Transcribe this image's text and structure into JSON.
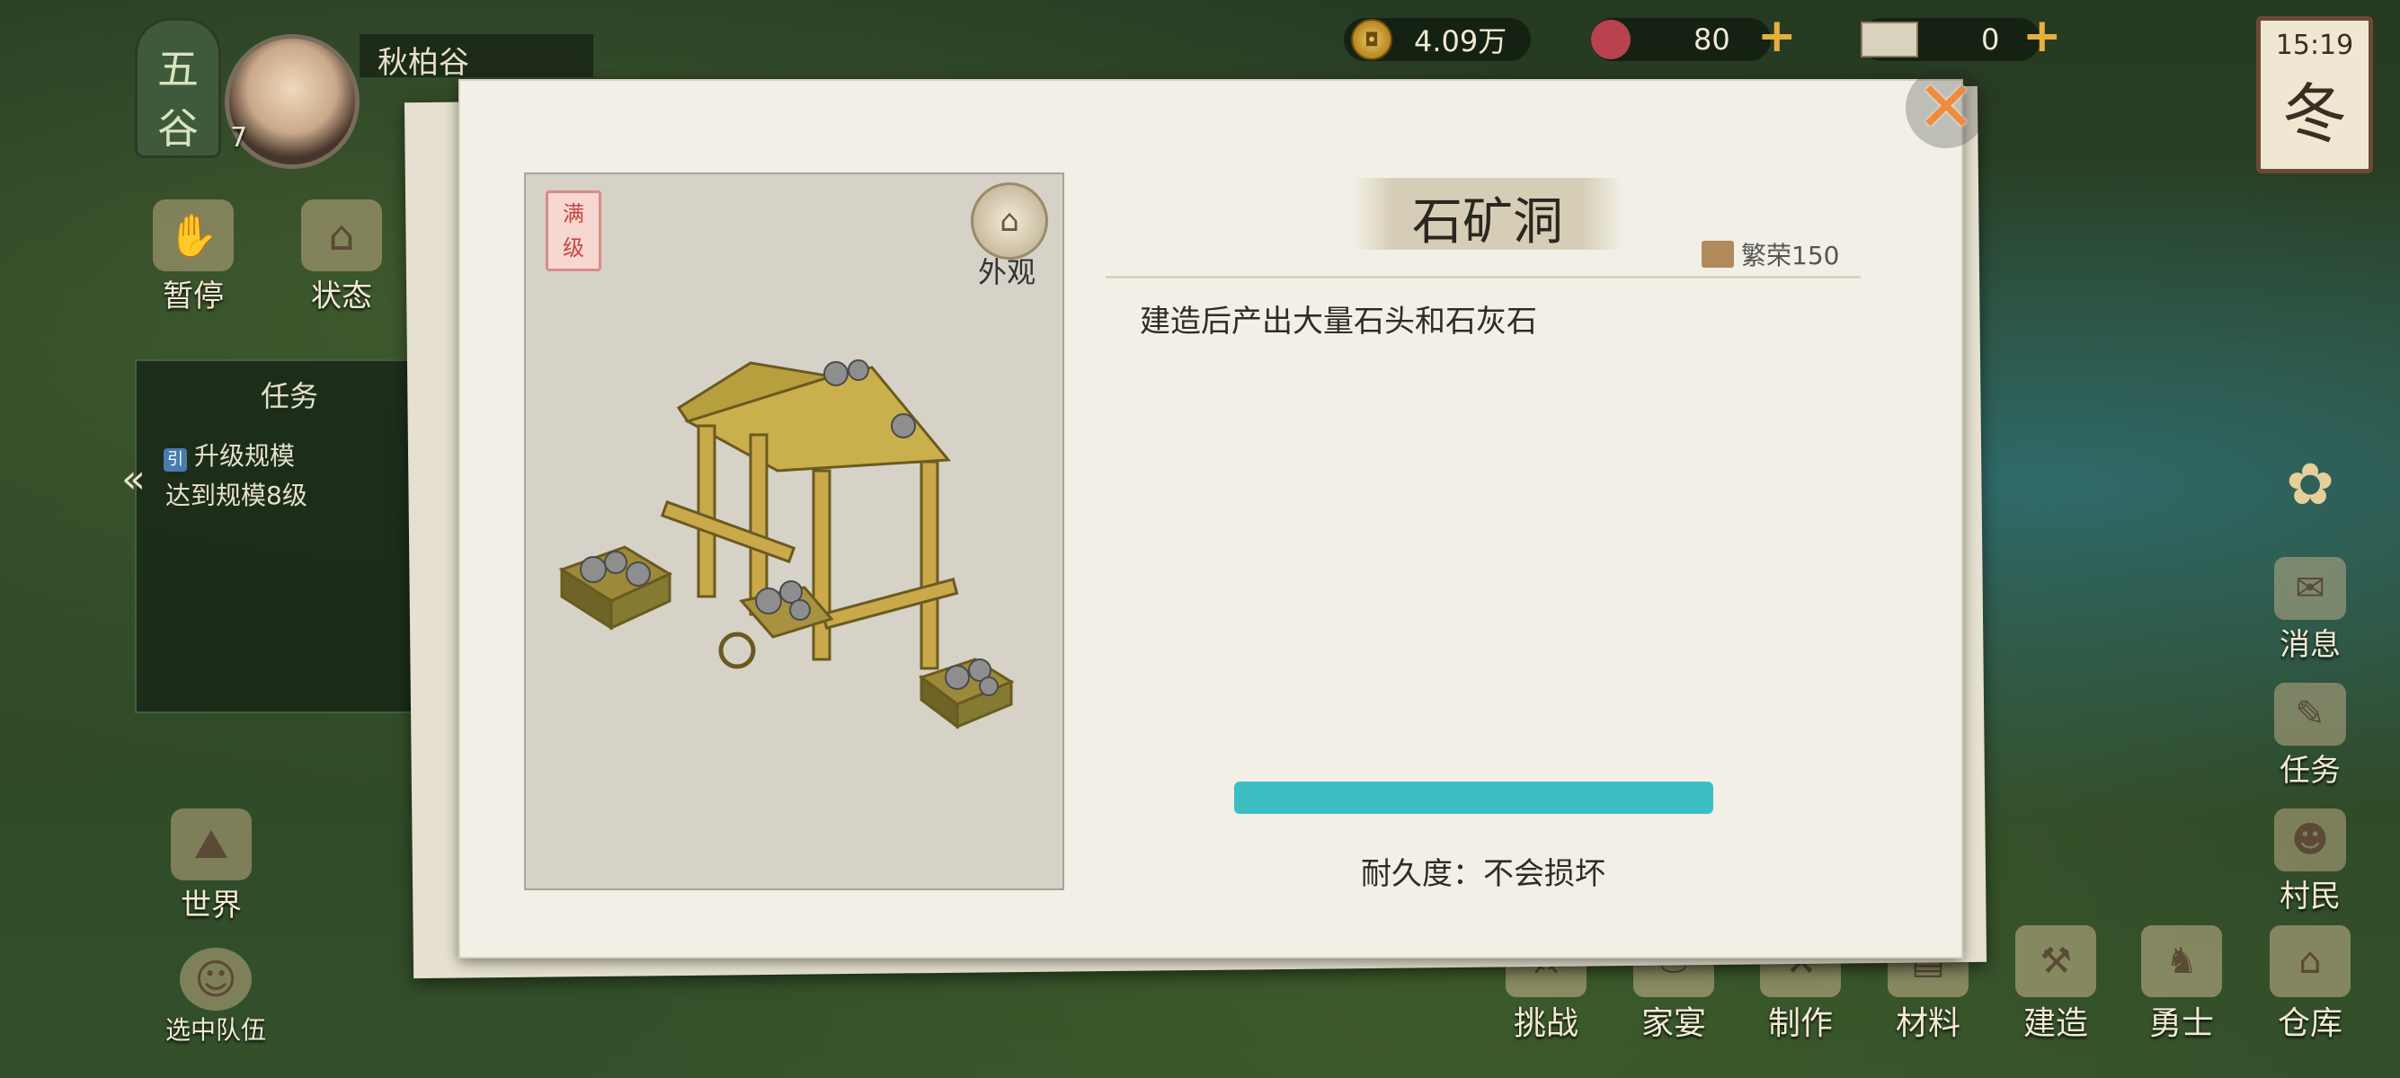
{
  "profile": {
    "region_top": "五",
    "region_bottom": "谷",
    "level": "7",
    "name": "秋柏谷"
  },
  "left_buttons": [
    {
      "label": "暂停",
      "icon": "pause-hand-icon"
    },
    {
      "label": "状态",
      "icon": "house-status-icon"
    }
  ],
  "task_panel": {
    "title": "任务",
    "marker": "引",
    "line1": "升级规模",
    "line2": "达到规模8级"
  },
  "bottom_left_buttons": [
    {
      "label": "世界",
      "icon": "world-map-icon"
    },
    {
      "label": "选中队伍",
      "icon": "team-portrait-icon"
    }
  ],
  "resources": {
    "coins": "4.09万",
    "res2": "80",
    "res3": "0"
  },
  "clock": {
    "time": "15:19",
    "season": "冬"
  },
  "right_buttons": [
    {
      "label": "消息",
      "icon": "message-icon"
    },
    {
      "label": "任务",
      "icon": "quest-scroll-icon"
    },
    {
      "label": "村民",
      "icon": "villager-icon"
    }
  ],
  "bottom_buttons": [
    {
      "label": "挑战",
      "icon": "challenge-icon"
    },
    {
      "label": "家宴",
      "icon": "feast-icon"
    },
    {
      "label": "制作",
      "icon": "craft-icon"
    },
    {
      "label": "材料",
      "icon": "materials-icon"
    },
    {
      "label": "建造",
      "icon": "build-hammer-icon"
    },
    {
      "label": "勇士",
      "icon": "warrior-icon"
    },
    {
      "label": "仓库",
      "icon": "warehouse-icon"
    }
  ],
  "dialog": {
    "max_badge": "满级",
    "appearance_label": "外观",
    "title": "石矿洞",
    "prosperity": "繁荣150",
    "description": "建造后产出大量石头和石灰石",
    "progress": 1.0,
    "durability": "耐久度：不会损坏",
    "accent_color": "#3cbfc2",
    "close_color": "#f08a3c"
  }
}
